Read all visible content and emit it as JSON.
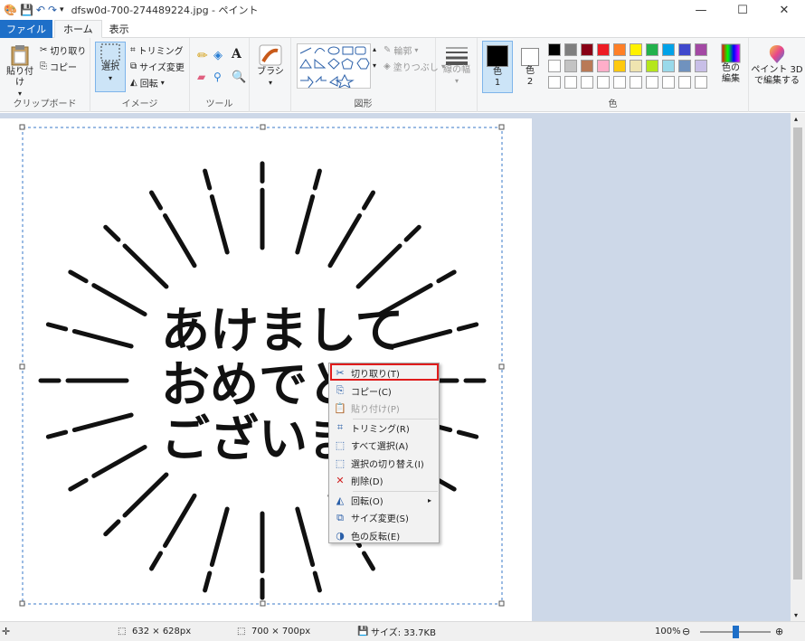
{
  "window": {
    "title": "dfsw0d-700-274489224.jpg - ペイント",
    "min": "—",
    "max": "☐",
    "close": "✕"
  },
  "tabs": [
    "ファイル",
    "ホーム",
    "表示"
  ],
  "ribbon": {
    "clipboard": {
      "label": "クリップボード",
      "paste": "貼り付け",
      "cut": "切り取り",
      "copy": "コピー"
    },
    "image": {
      "label": "イメージ",
      "select": "選択",
      "crop": "トリミング",
      "resize": "サイズ変更",
      "rotate": "回転"
    },
    "tools": {
      "label": "ツール"
    },
    "brush": {
      "label": "ブラシ"
    },
    "shapes": {
      "label": "図形",
      "outline": "輪郭",
      "fill": "塗りつぶし"
    },
    "size": {
      "label": "線の幅"
    },
    "colors": {
      "label": "色",
      "color1": "色\n1",
      "color1a": "色",
      "color1b": "1",
      "color2a": "色",
      "color2b": "2",
      "edit_a": "色の",
      "edit_b": "編集",
      "row1": [
        "#000000",
        "#7f7f7f",
        "#880015",
        "#ed1c24",
        "#ff7f27",
        "#fff200",
        "#22b14c",
        "#00a2e8",
        "#3f48cc",
        "#a349a4"
      ],
      "row2": [
        "#ffffff",
        "#c3c3c3",
        "#b97a57",
        "#ffaec9",
        "#ffc90e",
        "#efe4b0",
        "#b5e61d",
        "#99d9ea",
        "#7092be",
        "#c8bfe7"
      ]
    },
    "paint3d": {
      "a": "ペイント 3D",
      "b": "で編集する"
    }
  },
  "canvas_text": {
    "line1": "あけまして",
    "line2": "おめでと",
    "line3": "ございま"
  },
  "context_menu": [
    {
      "label": "切り取り(T)",
      "icon": "✂",
      "name": "cut",
      "enabled": true
    },
    {
      "label": "コピー(C)",
      "icon": "⎘",
      "name": "copy",
      "enabled": true
    },
    {
      "label": "貼り付け(P)",
      "icon": "📋",
      "name": "paste",
      "enabled": false
    },
    {
      "label": "トリミング(R)",
      "icon": "⌗",
      "name": "crop",
      "enabled": true
    },
    {
      "label": "すべて選択(A)",
      "icon": "⬚",
      "name": "select-all",
      "enabled": true
    },
    {
      "label": "選択の切り替え(I)",
      "icon": "⬚",
      "name": "invert-selection",
      "enabled": true
    },
    {
      "label": "削除(D)",
      "icon": "✕",
      "name": "delete",
      "enabled": true
    },
    {
      "label": "回転(O)",
      "icon": "◭",
      "name": "rotate",
      "enabled": true,
      "submenu": "▸"
    },
    {
      "label": "サイズ変更(S)",
      "icon": "⧉",
      "name": "resize",
      "enabled": true
    },
    {
      "label": "色の反転(E)",
      "icon": "◑",
      "name": "invert-color",
      "enabled": true
    }
  ],
  "status": {
    "selection": "632 × 628px",
    "image_size": "700 × 700px",
    "file_size": "サイズ: 33.7KB",
    "zoom": "100%",
    "zoom_level": 0.5
  }
}
